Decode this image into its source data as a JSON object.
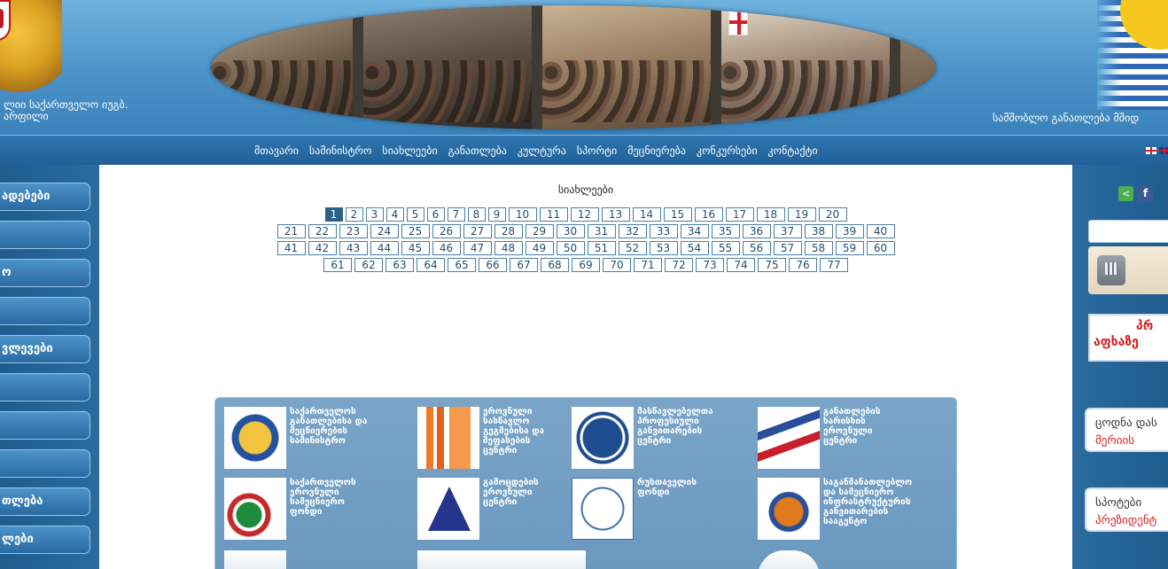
{
  "header": {
    "left_text": "ლიი საქართველო იუგბ.\nარფილი",
    "right_text": "სამშობლო განათლება მშიდ"
  },
  "nav": {
    "items": [
      "მთავარი",
      "სამინისტრო",
      "სიახლეები",
      "განათლება",
      "კულტურა",
      "სპორტი",
      "მეცნიერება",
      "კონკურსები",
      "კონტაქტი"
    ]
  },
  "left_menu": {
    "items": [
      "ადებები",
      "",
      "ო",
      "",
      "ვლევები",
      "",
      "",
      "",
      "თლება",
      "ლები"
    ]
  },
  "content": {
    "title": "სიახლეები",
    "pager": {
      "current": 1,
      "rows": [
        [
          "1",
          "2",
          "3",
          "4",
          "5",
          "6",
          "7",
          "8",
          "9",
          "10",
          "11",
          "12",
          "13",
          "14",
          "15",
          "16",
          "17",
          "18",
          "19",
          "20"
        ],
        [
          "21",
          "22",
          "23",
          "24",
          "25",
          "26",
          "27",
          "28",
          "29",
          "30",
          "31",
          "32",
          "33",
          "34",
          "35",
          "36",
          "37",
          "38",
          "39",
          "40"
        ],
        [
          "41",
          "42",
          "43",
          "44",
          "45",
          "46",
          "47",
          "48",
          "49",
          "50",
          "51",
          "52",
          "53",
          "54",
          "55",
          "56",
          "57",
          "58",
          "59",
          "60"
        ],
        [
          "61",
          "62",
          "63",
          "64",
          "65",
          "66",
          "67",
          "68",
          "69",
          "70",
          "71",
          "72",
          "73",
          "74",
          "75",
          "76",
          "77"
        ]
      ]
    },
    "partners": [
      {
        "label": "საქართველოს\nგანათლებისა და\nმეცნიერების\nსამინისტრო"
      },
      {
        "label": "ეროვნული\nსასწავლო\nგეგმებისა და\nშეფასების\nცენტრი"
      },
      {
        "label": "მასწავლებელთა\nპროფესიული\nგანვითარების\nცენტრი"
      },
      {
        "label": "განათლების\nხარისხის\nეროვნული\nცენტრი"
      },
      {
        "label": "საქართველოს\nეროვნული\nსამეცნიერო\nფონდი"
      },
      {
        "label": "გამოცდების\nეროვნული\nცენტრი"
      },
      {
        "label": "რუსთაველის\nფონდი"
      },
      {
        "label": "საგანმანათლებლო\nდა სამეცნიერო\nინფრასტრუქტურის\nგანვითარების\nსააგენტო"
      }
    ]
  },
  "right": {
    "share_icon": "share-icon",
    "fb_icon": "facebook-icon",
    "promo_l1": "პრ",
    "promo_l2": "აფხაზე",
    "box1_t1": "ცოდნა დას",
    "box1_t2": "მერიის",
    "box2_t1": "სპოტები",
    "box2_t2": "პრეზიდენტ"
  }
}
